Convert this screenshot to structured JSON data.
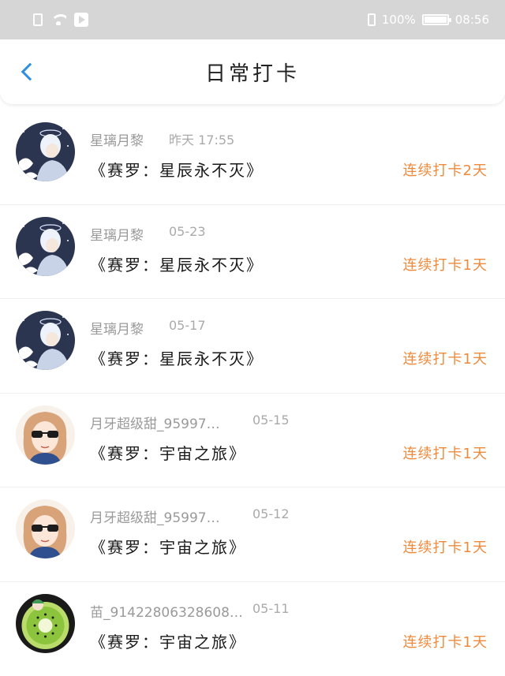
{
  "status_bar": {
    "battery": "100%",
    "time": "08:56"
  },
  "header": {
    "title": "日常打卡"
  },
  "colors": {
    "accent_blue": "#2f8fe0",
    "streak_orange": "#ef8a3c",
    "status_bar_bg": "#d6d6d6"
  },
  "items": [
    {
      "avatar": "anime-boy-avatar",
      "username": "星璃月黎",
      "time": "昨天 17:55",
      "title": "《赛罗：星辰永不灭》",
      "streak": "连续打卡2天"
    },
    {
      "avatar": "anime-boy-avatar",
      "username": "星璃月黎",
      "time": "05-23",
      "title": "《赛罗：星辰永不灭》",
      "streak": "连续打卡1天"
    },
    {
      "avatar": "anime-boy-avatar",
      "username": "星璃月黎",
      "time": "05-17",
      "title": "《赛罗：星辰永不灭》",
      "streak": "连续打卡1天"
    },
    {
      "avatar": "sunglasses-girl-avatar",
      "username": "月牙超级甜_95997…",
      "time": "05-15",
      "title": "《赛罗：宇宙之旅》",
      "streak": "连续打卡1天"
    },
    {
      "avatar": "sunglasses-girl-avatar",
      "username": "月牙超级甜_95997…",
      "time": "05-12",
      "title": "《赛罗：宇宙之旅》",
      "streak": "连续打卡1天"
    },
    {
      "avatar": "kiwi-avatar",
      "username": "苗_91422806328608…",
      "time": "05-11",
      "title": "《赛罗：宇宙之旅》",
      "streak": "连续打卡1天"
    }
  ]
}
